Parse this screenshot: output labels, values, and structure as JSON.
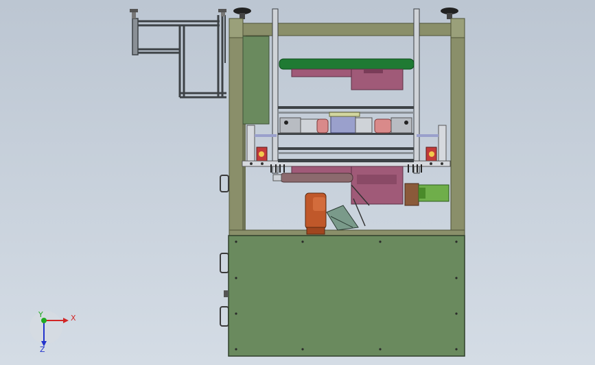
{
  "viewport": {
    "background_top": "#bcc6d2",
    "background_bottom": "#d4dce5"
  },
  "colors": {
    "frame": "#8a8f6a",
    "frame_dark": "#4d5236",
    "panel": "#6a8a5e",
    "panel_dark": "#3e5238",
    "extrusion": "#3d4246",
    "steel": "#b8bcc2",
    "green_roller": "#1f7a33",
    "mauve": "#a05a78",
    "motor_green": "#6fae4a",
    "robot_orange": "#c0582a",
    "axis_x": "#d12626",
    "axis_y": "#22aa22",
    "axis_z": "#2233cc"
  },
  "axis_triad": {
    "x_label": "X",
    "y_label": "Y",
    "z_label": "Z"
  }
}
